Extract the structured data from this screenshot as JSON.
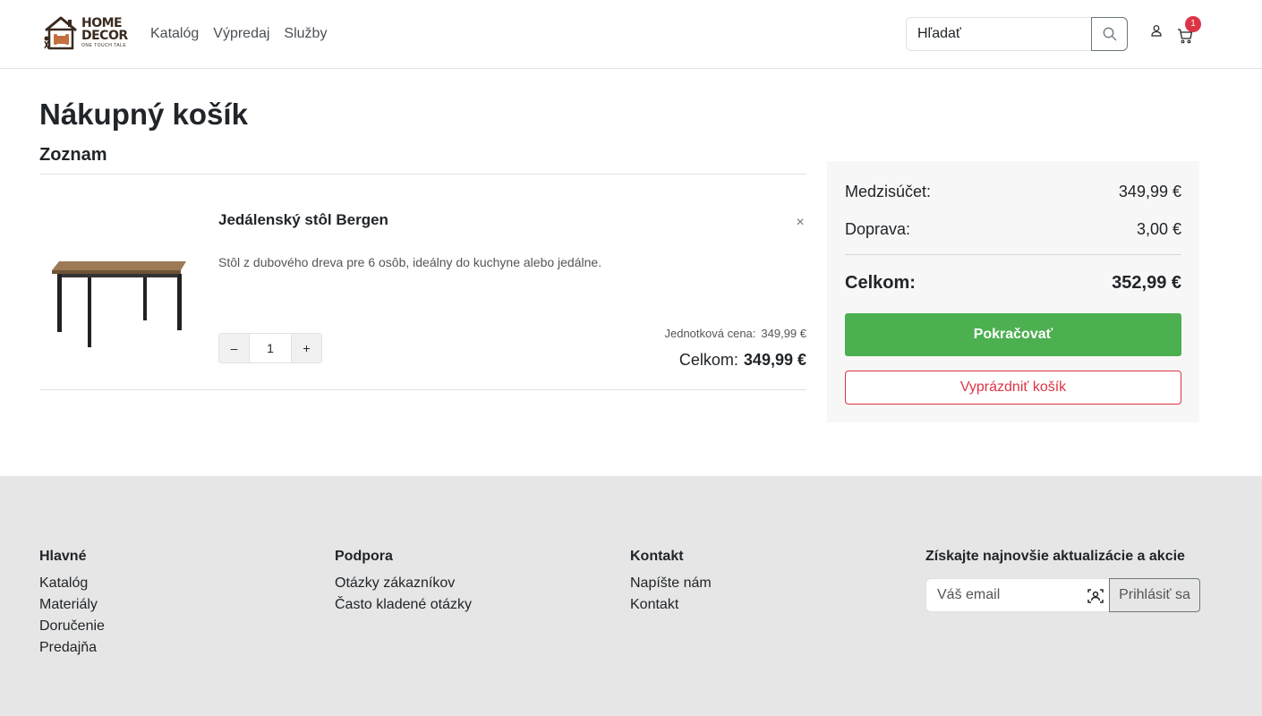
{
  "header": {
    "logo": {
      "line1": "HOME",
      "line2": "DECOR",
      "tagline": "ONE TOUCH TALE"
    },
    "nav": [
      "Katalóg",
      "Výpredaj",
      "Služby"
    ],
    "search_placeholder": "Hľadať",
    "cart_count": "1",
    "icons": {
      "search": "search-icon",
      "user": "user-icon",
      "cart": "cart-icon"
    }
  },
  "main": {
    "title": "Nákupný košík",
    "list_title": "Zoznam",
    "items": [
      {
        "name": "Jedálenský stôl Bergen",
        "description": "Stôl z dubového dreva pre 6 osôb, ideálny do kuchyne alebo jedálne.",
        "quantity": "1",
        "unit_price_label": "Jednotková cena:",
        "unit_price": "349,99 €",
        "total_label": "Celkom:",
        "total": "349,99 €",
        "remove": "×",
        "minus": "–",
        "plus": "+"
      }
    ]
  },
  "summary": {
    "subtotal_label": "Medzisúčet:",
    "subtotal": "349,99 €",
    "shipping_label": "Doprava:",
    "shipping": "3,00 €",
    "total_label": "Celkom:",
    "total": "352,99 €",
    "continue_label": "Pokračovať",
    "empty_label": "Vyprázdniť košík",
    "colors": {
      "continue": "#4caf50",
      "empty": "#dc3545"
    }
  },
  "footer": {
    "columns": [
      {
        "title": "Hlavné",
        "links": [
          "Katalóg",
          "Materiály",
          "Doručenie",
          "Predajňa"
        ]
      },
      {
        "title": "Podpora",
        "links": [
          "Otázky zákazníkov",
          "Často kladené otázky"
        ]
      },
      {
        "title": "Kontakt",
        "links": [
          "Napíšte nám",
          "Kontakt"
        ]
      }
    ],
    "newsletter": {
      "title": "Získajte najnovšie aktualizácie a akcie",
      "placeholder": "Váš email",
      "button": "Prihlásiť sa"
    }
  }
}
